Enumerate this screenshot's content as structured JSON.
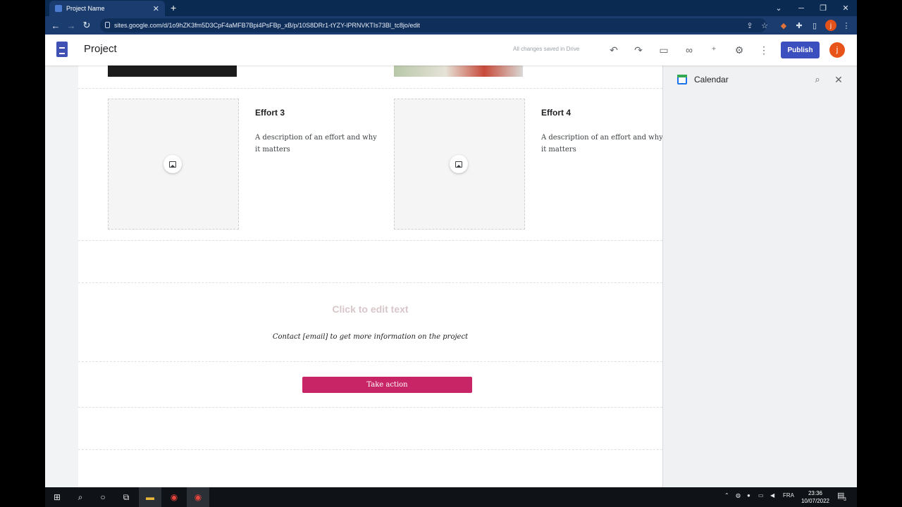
{
  "browser": {
    "tab_title": "Project Name",
    "new_tab": "+",
    "url": "sites.google.com/d/1o9hZK3fm5D3CpF4aMFB7Bpi4PsFBp_xB/p/10S8DRr1-tYZY-lPRNVKTIs73Bl_tc8jo/edit",
    "profile_letter": "j"
  },
  "sites": {
    "title": "Project",
    "saved_status": "All changes saved in Drive",
    "publish_label": "Publish",
    "avatar_letter": "j"
  },
  "page": {
    "efforts": [
      {
        "title": "Effort 3",
        "description": "A description of an effort and why it matters"
      },
      {
        "title": "Effort 4",
        "description": "A description of an effort and why it matters"
      }
    ],
    "click_to_edit": "Click to edit text",
    "contact": "Contact [email] to get more information on the project",
    "cta_label": "Take action"
  },
  "panel": {
    "title": "Calendar"
  },
  "taskbar": {
    "language": "FRA",
    "time": "23:36",
    "date": "10/07/2022",
    "notifications": "3"
  },
  "colors": {
    "publish": "#3c4fbf",
    "cta": "#c82567",
    "avatar": "#e8531a"
  }
}
